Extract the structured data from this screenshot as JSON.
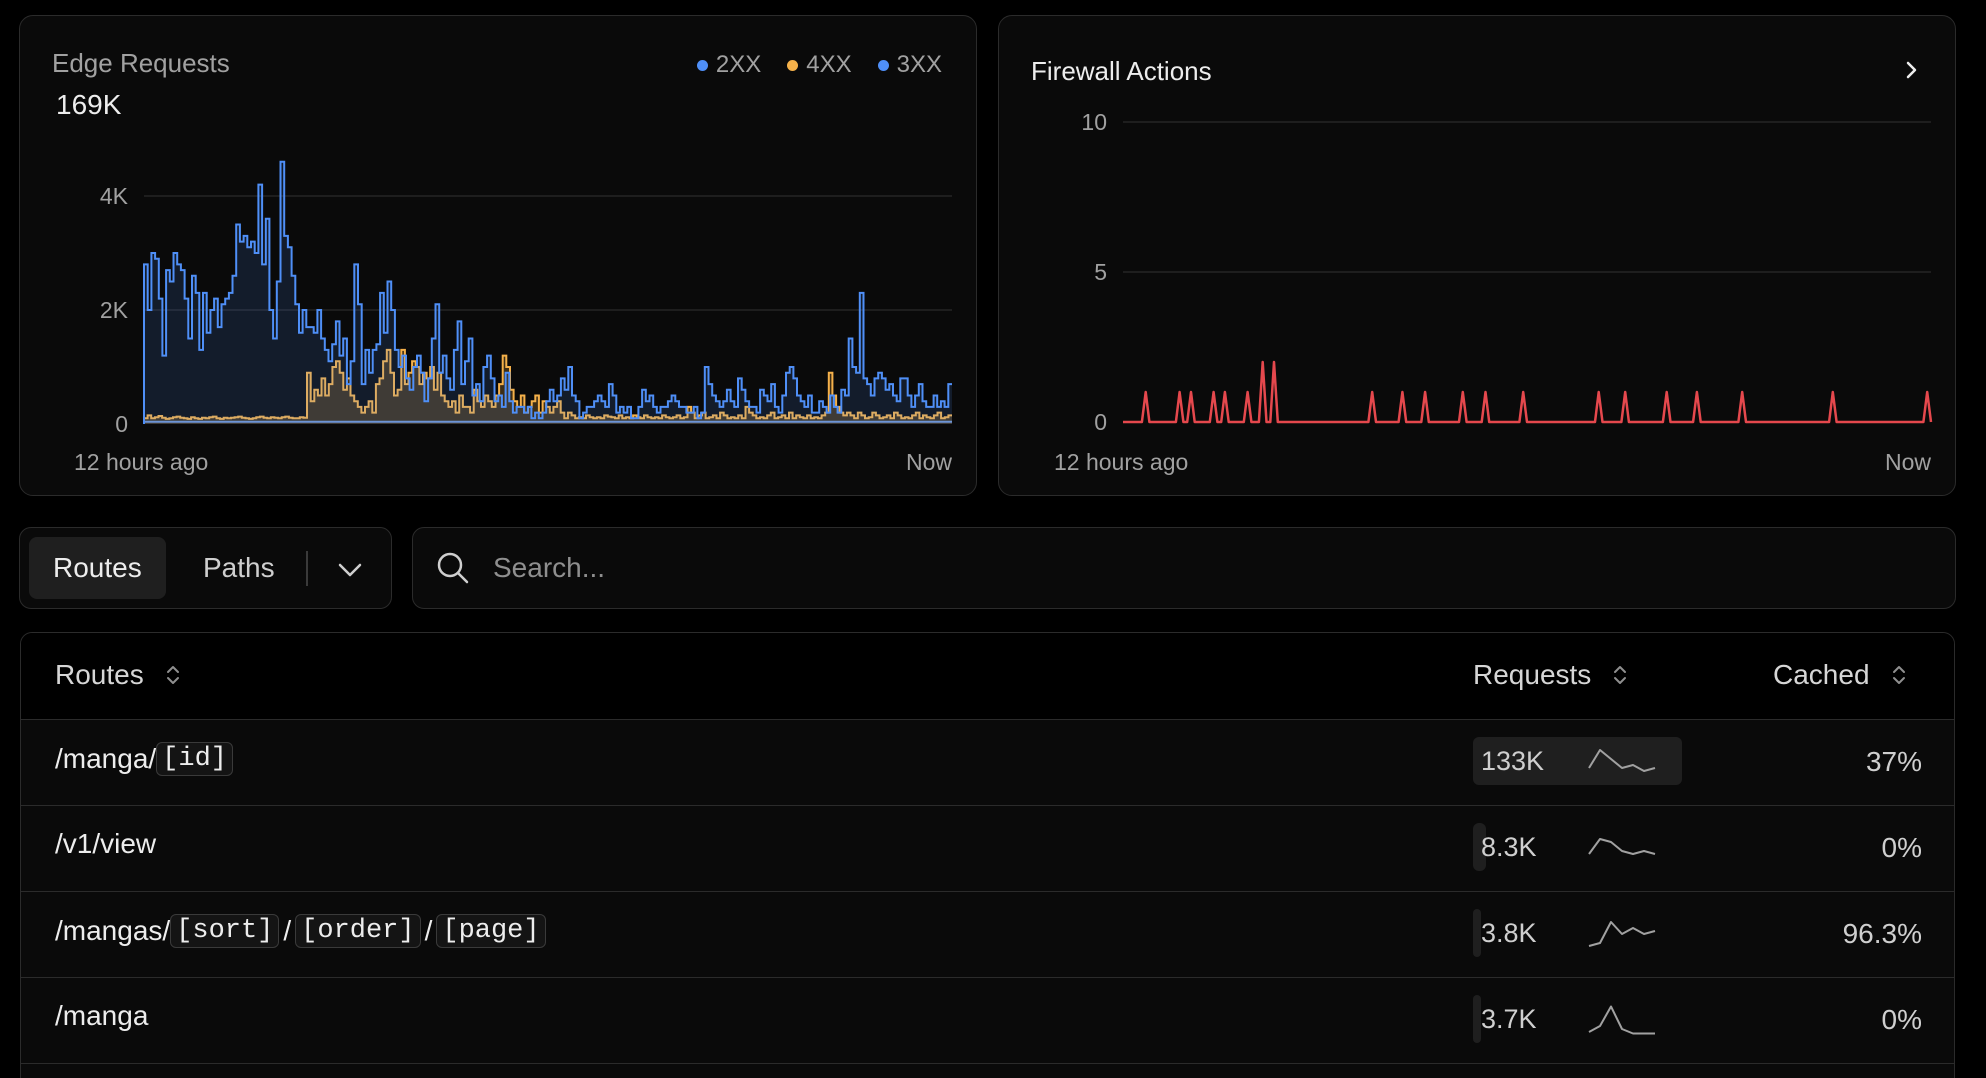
{
  "colors": {
    "status_2xx": "#4f8ff7",
    "status_4xx": "#f5b14a",
    "status_3xx": "#4f8ff7",
    "firewall": "#e5484d"
  },
  "edge_requests": {
    "title": "Edge Requests",
    "total": "169K",
    "legend": [
      {
        "label": "2XX",
        "color": "#4f8ff7"
      },
      {
        "label": "4XX",
        "color": "#f5b14a"
      },
      {
        "label": "3XX",
        "color": "#4f8ff7"
      }
    ],
    "y_ticks": [
      "4K",
      "2K",
      "0"
    ],
    "x_start": "12 hours ago",
    "x_end": "Now"
  },
  "firewall_actions": {
    "title": "Firewall Actions",
    "chevron_icon": "chevron-right-icon",
    "y_ticks": [
      "10",
      "5",
      "0"
    ],
    "x_start": "12 hours ago",
    "x_end": "Now"
  },
  "chart_data": [
    {
      "type": "area",
      "title": "Edge Requests",
      "x_range": [
        "12 hours ago",
        "Now"
      ],
      "ylim": [
        0,
        4600
      ],
      "y_ticks": [
        0,
        2000,
        4000
      ],
      "grid": true,
      "legend_position": "top-right",
      "series": [
        {
          "name": "2XX",
          "color": "#4f8ff7",
          "values": [
            2800,
            2000,
            3000,
            2900,
            2200,
            1200,
            2700,
            2500,
            3000,
            2800,
            2700,
            2200,
            1500,
            2600,
            2300,
            1300,
            2300,
            1600,
            2000,
            2200,
            1700,
            2100,
            2200,
            2300,
            2600,
            3500,
            3200,
            3300,
            3100,
            3200,
            3000,
            4200,
            2800,
            3600,
            2000,
            1500,
            2500,
            4600,
            3300,
            3100,
            2600,
            2100,
            1600,
            2000,
            1700,
            1700,
            1600,
            2000,
            1500,
            1300,
            1100,
            1400,
            1800,
            1200,
            1500,
            700,
            1100,
            2800,
            2100,
            700,
            1300,
            900,
            1300,
            1400,
            2300,
            1600,
            2500,
            2000,
            1300,
            1000,
            1200,
            800,
            600,
            1000,
            1200,
            900,
            400,
            800,
            1500,
            2100,
            900,
            1200,
            800,
            600,
            1300,
            1800,
            700,
            1100,
            1500,
            500,
            700,
            400,
            1000,
            1200,
            800,
            400,
            500,
            300,
            900,
            400,
            200,
            300,
            300,
            200,
            300,
            100,
            200,
            100,
            200,
            400,
            600,
            400,
            500,
            800,
            600,
            1000,
            500,
            400,
            100,
            200,
            300,
            300,
            400,
            500,
            400,
            300,
            700,
            500,
            200,
            300,
            200,
            300,
            100,
            100,
            300,
            600,
            400,
            500,
            300,
            200,
            300,
            300,
            400,
            500,
            400,
            300,
            300,
            200,
            200,
            300,
            100,
            200,
            1000,
            700,
            500,
            400,
            300,
            400,
            600,
            400,
            300,
            800,
            600,
            400,
            300,
            300,
            200,
            600,
            500,
            400,
            700,
            300,
            200,
            500,
            900,
            1000,
            800,
            500,
            400,
            300,
            500,
            200,
            200,
            400,
            300,
            200,
            500,
            300,
            200,
            600,
            500,
            1500,
            1000,
            900,
            2300,
            800,
            700,
            500,
            800,
            900,
            800,
            600,
            700,
            500,
            400,
            800,
            800,
            500,
            300,
            500,
            700,
            400,
            300,
            300,
            500,
            300,
            400,
            300,
            700
          ]
        },
        {
          "name": "4XX",
          "color": "#f5b14a",
          "values": [
            100,
            150,
            100,
            120,
            140,
            110,
            90,
            100,
            120,
            130,
            110,
            100,
            90,
            120,
            100,
            90,
            110,
            100,
            120,
            130,
            100,
            90,
            110,
            100,
            110,
            120,
            130,
            110,
            100,
            90,
            100,
            120,
            130,
            110,
            100,
            120,
            110,
            100,
            120,
            130,
            110,
            100,
            100,
            120,
            110,
            900,
            400,
            600,
            500,
            800,
            500,
            700,
            1000,
            1100,
            900,
            600,
            800,
            500,
            400,
            300,
            200,
            300,
            400,
            200,
            700,
            800,
            1100,
            1300,
            900,
            500,
            600,
            1300,
            700,
            900,
            1100,
            1000,
            700,
            900,
            800,
            1000,
            600,
            900,
            500,
            400,
            300,
            400,
            200,
            500,
            300,
            300,
            200,
            600,
            400,
            300,
            500,
            400,
            300,
            500,
            700,
            1200,
            1000,
            600,
            400,
            300,
            500,
            200,
            300,
            400,
            500,
            200,
            400,
            300,
            200,
            300,
            400,
            200,
            100,
            200,
            150,
            100,
            120,
            100,
            150,
            120,
            100,
            120,
            100,
            150,
            130,
            120,
            100,
            150,
            100,
            120,
            100,
            150,
            120,
            100,
            150,
            120,
            100,
            120,
            100,
            150,
            120,
            100,
            120,
            150,
            100,
            120,
            300,
            200,
            100,
            150,
            200,
            100,
            120,
            150,
            100,
            200,
            150,
            100,
            120,
            100,
            150,
            100,
            300,
            200,
            150,
            100,
            120,
            100,
            150,
            200,
            100,
            120,
            150,
            100,
            200,
            100,
            150,
            120,
            100,
            150,
            100,
            120,
            100,
            150,
            200,
            900,
            500,
            300,
            200,
            150,
            200,
            150,
            100,
            200,
            150,
            100,
            120,
            200,
            150,
            100,
            120,
            150,
            100,
            200,
            150,
            100,
            120,
            100,
            150,
            200,
            100,
            150,
            120,
            100,
            150,
            200,
            100,
            120,
            150
          ]
        },
        {
          "name": "3XX",
          "color": "#4f8ff7",
          "values": [
            40,
            40,
            40,
            40,
            40,
            40,
            40,
            40,
            40,
            40,
            40,
            40,
            40,
            40,
            40,
            40,
            40,
            40,
            40,
            40,
            40,
            40,
            40,
            40,
            40,
            40,
            40,
            40,
            40,
            40,
            40,
            40,
            40,
            40,
            40,
            40,
            40,
            40,
            40,
            40,
            40,
            40,
            40,
            40,
            40,
            40,
            40,
            40,
            40,
            40,
            40,
            40,
            40,
            40,
            40,
            40,
            40,
            40,
            40,
            40,
            40,
            40,
            40,
            40,
            40,
            40,
            40,
            40,
            40,
            40,
            40,
            40,
            40,
            40,
            40,
            40,
            40,
            40,
            40,
            40,
            40,
            40,
            40,
            40,
            40,
            40,
            40,
            40,
            40,
            40,
            40,
            40,
            40,
            40,
            40,
            40,
            40,
            40,
            40,
            40,
            40,
            40,
            40,
            40,
            40,
            40,
            40,
            40,
            40,
            40,
            40,
            40,
            40,
            40,
            40,
            40,
            40,
            40,
            40,
            40,
            40,
            40,
            40,
            40,
            40,
            40,
            40,
            40,
            40,
            40,
            40,
            40,
            40,
            40,
            40,
            40,
            40,
            40,
            40,
            40,
            40,
            40,
            40,
            40,
            40,
            40,
            40,
            40,
            40,
            40,
            40,
            40,
            40,
            40,
            40,
            40,
            40,
            40,
            40,
            40,
            40,
            40,
            40,
            40,
            40,
            40,
            40,
            40,
            40,
            40,
            40,
            40,
            40,
            40,
            40,
            40,
            40,
            40,
            40,
            40,
            40,
            40,
            40,
            40,
            40,
            40,
            40,
            40,
            40,
            40,
            40,
            40,
            40,
            40,
            40,
            40,
            40,
            40,
            40,
            40,
            40,
            40,
            40,
            40,
            40,
            40,
            40,
            40,
            40,
            40,
            40,
            40,
            40,
            40,
            40,
            40,
            40,
            40,
            40,
            40
          ]
        }
      ]
    },
    {
      "type": "line",
      "title": "Firewall Actions",
      "x_range": [
        "12 hours ago",
        "Now"
      ],
      "ylim": [
        0,
        10
      ],
      "y_ticks": [
        0,
        5,
        10
      ],
      "grid": true,
      "series": [
        {
          "color": "#e5484d",
          "values": [
            0,
            0,
            0,
            0,
            0,
            0,
            1,
            0,
            0,
            0,
            0,
            0,
            0,
            0,
            0,
            1,
            0,
            0,
            1,
            0,
            0,
            0,
            0,
            0,
            1,
            0,
            0,
            1,
            0,
            0,
            0,
            0,
            0,
            1,
            0,
            0,
            0,
            2,
            0,
            0,
            2,
            0,
            0,
            0,
            0,
            0,
            0,
            0,
            0,
            0,
            0,
            0,
            0,
            0,
            0,
            0,
            0,
            0,
            0,
            0,
            0,
            0,
            0,
            0,
            0,
            0,
            1,
            0,
            0,
            0,
            0,
            0,
            0,
            0,
            1,
            0,
            0,
            0,
            0,
            0,
            1,
            0,
            0,
            0,
            0,
            0,
            0,
            0,
            0,
            0,
            1,
            0,
            0,
            0,
            0,
            0,
            1,
            0,
            0,
            0,
            0,
            0,
            0,
            0,
            0,
            0,
            1,
            0,
            0,
            0,
            0,
            0,
            0,
            0,
            0,
            0,
            0,
            0,
            0,
            0,
            0,
            0,
            0,
            0,
            0,
            0,
            1,
            0,
            0,
            0,
            0,
            0,
            0,
            1,
            0,
            0,
            0,
            0,
            0,
            0,
            0,
            0,
            0,
            0,
            1,
            0,
            0,
            0,
            0,
            0,
            0,
            0,
            1,
            0,
            0,
            0,
            0,
            0,
            0,
            0,
            0,
            0,
            0,
            0,
            1,
            0,
            0,
            0,
            0,
            0,
            0,
            0,
            0,
            0,
            0,
            0,
            0,
            0,
            0,
            0,
            0,
            0,
            0,
            0,
            0,
            0,
            0,
            0,
            1,
            0,
            0,
            0,
            0,
            0,
            0,
            0,
            0,
            0,
            0,
            0,
            0,
            0,
            0,
            0,
            0,
            0,
            0,
            0,
            0,
            0,
            0,
            0,
            0,
            1,
            0
          ]
        }
      ]
    }
  ],
  "tabs": [
    {
      "label": "Routes",
      "active": true
    },
    {
      "label": "Paths",
      "active": false
    }
  ],
  "tab_dropdown_icon": "chevron-down-icon",
  "search": {
    "icon": "search-icon",
    "placeholder": "Search..."
  },
  "table": {
    "columns": [
      {
        "label": "Routes",
        "sort_icon": "sort-icon"
      },
      {
        "label": "Requests",
        "sort_icon": "sort-icon"
      },
      {
        "label": "Cached",
        "sort_icon": "sort-icon"
      }
    ],
    "rows": [
      {
        "route_prefix": "/manga/",
        "segments": [
          {
            "text": "[id]",
            "sep": ""
          }
        ],
        "requests": "133K",
        "request_share": 1.0,
        "cached": "37%",
        "spark": [
          0.3,
          0.9,
          0.6,
          0.3,
          0.4,
          0.2,
          0.3
        ]
      },
      {
        "route_prefix": "/v1/view",
        "segments": [],
        "requests": "8.3K",
        "request_share": 0.06,
        "cached": "0%",
        "spark": [
          0.3,
          0.8,
          0.7,
          0.4,
          0.3,
          0.4,
          0.3
        ]
      },
      {
        "route_prefix": "/mangas/",
        "segments": [
          {
            "text": "[sort]",
            "sep": "/"
          },
          {
            "text": "[order]",
            "sep": "/"
          },
          {
            "text": "[page]",
            "sep": ""
          }
        ],
        "requests": "3.8K",
        "request_share": 0.03,
        "cached": "96.3%",
        "spark": [
          0.1,
          0.2,
          0.9,
          0.5,
          0.7,
          0.5,
          0.6
        ]
      },
      {
        "route_prefix": "/manga",
        "segments": [],
        "requests": "3.7K",
        "request_share": 0.03,
        "cached": "0%",
        "spark": [
          0.1,
          0.3,
          0.95,
          0.2,
          0.05,
          0.05,
          0.05
        ]
      }
    ]
  }
}
